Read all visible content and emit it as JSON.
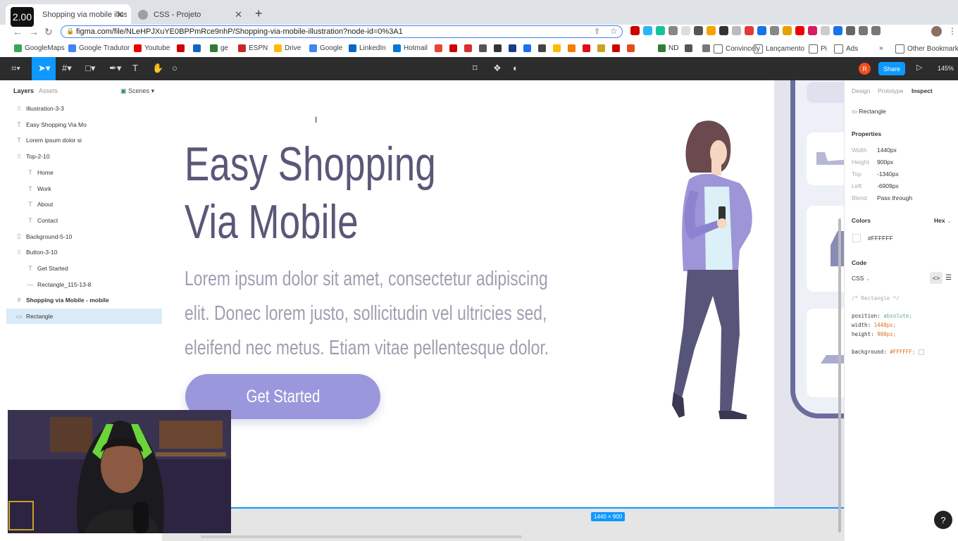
{
  "playback_speed": "2.00",
  "browser": {
    "tabs": [
      {
        "title": "Shopping via mobile illustration",
        "favicon": "figma-icon"
      },
      {
        "title": "CSS - Projeto",
        "favicon": "globe-icon"
      }
    ],
    "url": "figma.com/file/NLeHPJXuYE0BPPmRce9nhP/Shopping-via-mobile-illustration?node-id=0%3A1",
    "bookmarks": [
      "GoogleMaps",
      "Google Tradutor",
      "Youtube",
      "ge",
      "ESPN",
      "Drive",
      "Google",
      "LinkedIn",
      "Hotmail",
      "ND",
      "Convincely",
      "Lançamento",
      "Pi",
      "Ads",
      "Other Bookmarks"
    ]
  },
  "figma": {
    "share_label": "Share",
    "user_initial": "R",
    "zoom": "145%",
    "left_panel": {
      "tabs": [
        "Layers",
        "Assets"
      ],
      "scenes_label": "Scenes",
      "layers": [
        {
          "name": "Illustration-3-3",
          "icon": "dotted-frame-icon",
          "indent": 0
        },
        {
          "name": "Easy Shopping Via Mo",
          "icon": "text-icon",
          "indent": 0
        },
        {
          "name": "Lorem ipsum dolor si",
          "icon": "text-icon",
          "indent": 0
        },
        {
          "name": "Top-2-10",
          "icon": "dotted-frame-icon",
          "indent": 0
        },
        {
          "name": "Home",
          "icon": "text-icon",
          "indent": 1
        },
        {
          "name": "Work",
          "icon": "text-icon",
          "indent": 1
        },
        {
          "name": "About",
          "icon": "text-icon",
          "indent": 1
        },
        {
          "name": "Contact",
          "icon": "text-icon",
          "indent": 1
        },
        {
          "name": "Background-5-10",
          "icon": "rectangle-outline-icon",
          "indent": 0
        },
        {
          "name": "Button-3-10",
          "icon": "dotted-frame-icon",
          "indent": 0
        },
        {
          "name": "Get Started",
          "icon": "text-icon",
          "indent": 1
        },
        {
          "name": "Rectangle_115-13-8",
          "icon": "line-icon",
          "indent": 1
        },
        {
          "name": "Shopping via Mobile - mobile",
          "icon": "frame-icon",
          "indent": 0
        },
        {
          "name": "Rectangle",
          "icon": "rectangle-icon",
          "indent": 0,
          "selected": true
        }
      ]
    },
    "canvas": {
      "heading_line1": "Easy Shopping",
      "heading_line2": "Via Mobile",
      "body_lines": [
        "Lorem ipsum dolor sit amet, consectetur  adipiscing",
        "elit. Donec lorem justo, sollicitudin vel ultricies sed,",
        "eleifend nec metus. Etiam vitae pellentesque dolor."
      ],
      "cta_label": "Get Started",
      "frame_size_label": "1440 × 900",
      "accent_color": "#9B97DC",
      "heading_color": "#5A5878"
    },
    "inspect": {
      "tabs": [
        "Design",
        "Prototype",
        "Inspect"
      ],
      "selected_name": "Rectangle",
      "properties_title": "Properties",
      "properties": [
        {
          "label": "Width",
          "value": "1440px"
        },
        {
          "label": "Height",
          "value": "900px"
        },
        {
          "label": "Top",
          "value": "-1340px"
        },
        {
          "label": "Left",
          "value": "-6909px"
        },
        {
          "label": "Blend",
          "value": "Pass through"
        }
      ],
      "colors_title": "Colors",
      "color_format": "Hex",
      "color_value": "#FFFFFF",
      "code_title": "Code",
      "code_lang": "CSS",
      "code_comment": "/* Rectangle */",
      "code_lines": [
        {
          "prop": "position:",
          "val": "absolute;"
        },
        {
          "prop": "width:",
          "val": "1440px;"
        },
        {
          "prop": "height:",
          "val": "900px;"
        }
      ],
      "code_bg_prop": "background:",
      "code_bg_val": "#FFFFFF;"
    }
  }
}
